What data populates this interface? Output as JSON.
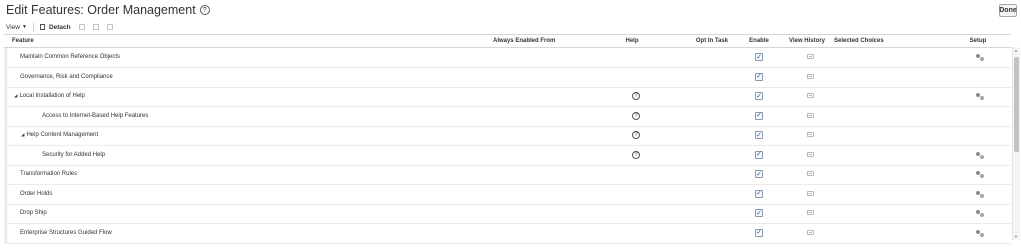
{
  "page": {
    "title": "Edit Features: Order Management",
    "done_label": "Done"
  },
  "toolbar": {
    "view_label": "View",
    "detach_label": "Detach"
  },
  "table": {
    "columns": {
      "feature": "Feature",
      "always_enabled_from": "Always Enabled From",
      "help": "Help",
      "opt_in_task": "Opt In Task",
      "enable": "Enable",
      "view_history": "View History",
      "selected_choices": "Selected Choices",
      "setup": "Setup"
    },
    "rows": [
      {
        "feature": "Maintain Common Reference Objects",
        "level": 0,
        "expandable": false,
        "help": false,
        "enabled": true,
        "setup": true
      },
      {
        "feature": "Governance, Risk and Compliance",
        "level": 0,
        "expandable": false,
        "help": false,
        "enabled": true,
        "setup": false
      },
      {
        "feature": "Local Installation of Help",
        "level": 0,
        "expandable": true,
        "help": true,
        "enabled": true,
        "setup": true
      },
      {
        "feature": "Access to Internet-Based Help Features",
        "level": 2,
        "expandable": false,
        "help": true,
        "enabled": true,
        "setup": false
      },
      {
        "feature": "Help Content Management",
        "level": 1,
        "expandable": true,
        "help": true,
        "enabled": true,
        "setup": false
      },
      {
        "feature": "Security for Added Help",
        "level": 3,
        "expandable": false,
        "help": true,
        "enabled": true,
        "setup": true
      },
      {
        "feature": "Transformation Rules",
        "level": 0,
        "expandable": false,
        "help": false,
        "enabled": true,
        "setup": true
      },
      {
        "feature": "Order Holds",
        "level": 0,
        "expandable": false,
        "help": false,
        "enabled": true,
        "setup": true
      },
      {
        "feature": "Drop Ship",
        "level": 0,
        "expandable": false,
        "help": false,
        "enabled": true,
        "setup": true
      },
      {
        "feature": "Enterprise Structures Guided Flow",
        "level": 0,
        "expandable": false,
        "help": false,
        "enabled": true,
        "setup": true
      }
    ]
  }
}
